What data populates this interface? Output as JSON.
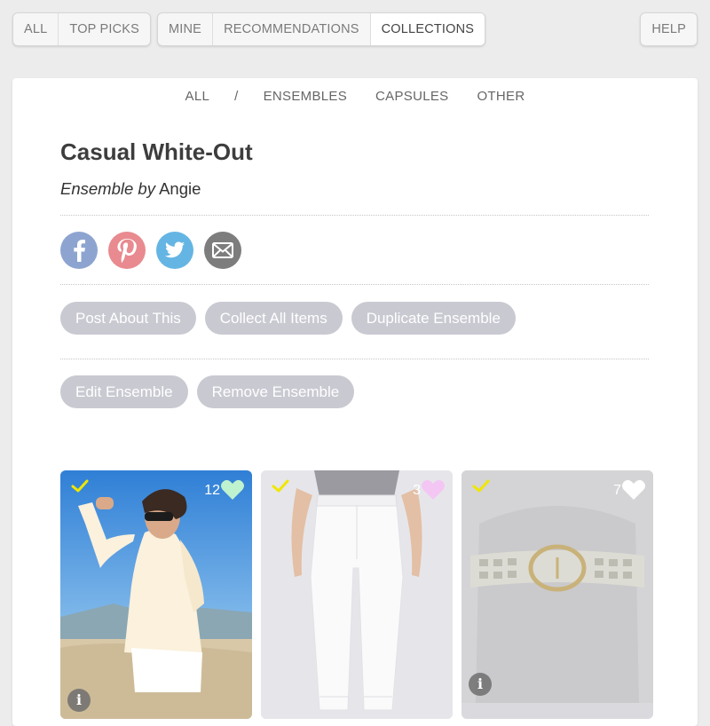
{
  "top_nav": {
    "group_left": [
      "ALL",
      "TOP PICKS"
    ],
    "group_mid": [
      "MINE",
      "RECOMMENDATIONS",
      "COLLECTIONS"
    ],
    "active_tab": "COLLECTIONS",
    "help_label": "HELP"
  },
  "sub_nav": {
    "items": [
      "ALL",
      "/",
      "ENSEMBLES",
      "CAPSULES",
      "OTHER"
    ]
  },
  "ensemble": {
    "title": "Casual White-Out",
    "type_label": "Ensemble by",
    "author": "Angie"
  },
  "social_icons": [
    "facebook-icon",
    "pinterest-icon",
    "twitter-icon",
    "email-icon"
  ],
  "social_colors": {
    "facebook": "#8ea4d0",
    "pinterest": "#e88a8f",
    "twitter": "#64b5e3",
    "email": "#7d7d7d"
  },
  "actions_row1": [
    "Post About This",
    "Collect All Items",
    "Duplicate Ensemble"
  ],
  "actions_row2": [
    "Edit Ensemble",
    "Remove Ensemble"
  ],
  "items": [
    {
      "name": "Cream Sweater with White Shorts",
      "likes": "12",
      "heart_color": "#bff2cf",
      "checked": true,
      "has_info": true
    },
    {
      "name": "White Jeans",
      "likes": "3",
      "heart_color": "#f4c6f4",
      "checked": true,
      "has_info": false
    },
    {
      "name": "White Leather Belt",
      "likes": "7",
      "heart_color": "#ffffff",
      "checked": true,
      "has_info": true
    }
  ],
  "colors": {
    "pill_bg": "#c9c9d2",
    "check": "#f0e600",
    "panel_bg": "#ffffff",
    "page_bg": "#ececec"
  }
}
